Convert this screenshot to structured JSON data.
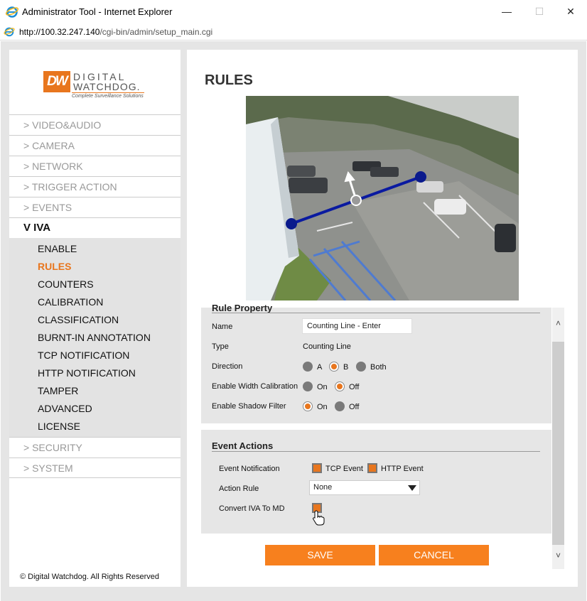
{
  "window": {
    "title": "Administrator Tool - Internet Explorer",
    "url_host": "http://100.32.247.140",
    "url_path": "/cgi-bin/admin/setup_main.cgi",
    "minimize": "—",
    "maximize": "☐",
    "close": "✕"
  },
  "logo": {
    "mark": "DW",
    "line1": "DIGITAL",
    "line2": "WATCHDOG.",
    "tagline": "Complete Surveillance Solutions"
  },
  "nav": {
    "items_top": [
      "> VIDEO&AUDIO",
      "> CAMERA",
      "> NETWORK",
      "> TRIGGER ACTION",
      "> EVENTS"
    ],
    "active": "V IVA",
    "sub_items": [
      "ENABLE",
      "RULES",
      "COUNTERS",
      "CALIBRATION",
      "CLASSIFICATION",
      "BURNT-IN ANNOTATION",
      "TCP NOTIFICATION",
      "HTTP NOTIFICATION",
      "TAMPER",
      "ADVANCED",
      "LICENSE"
    ],
    "current_sub": "RULES",
    "items_bottom": [
      "> SECURITY",
      "> SYSTEM"
    ]
  },
  "copyright": "© Digital Watchdog. All Rights Reserved",
  "page": {
    "title": "RULES"
  },
  "rule_property": {
    "section_title": "Rule Property",
    "name_label": "Name",
    "name_value": "Counting Line - Enter",
    "type_label": "Type",
    "type_value": "Counting Line",
    "direction_label": "Direction",
    "direction_options": [
      "A",
      "B",
      "Both"
    ],
    "direction_selected": "B",
    "width_cal_label": "Enable Width Calibration",
    "width_cal_on": "On",
    "width_cal_off": "Off",
    "width_cal_selected": "Off",
    "shadow_label": "Enable Shadow Filter",
    "shadow_on": "On",
    "shadow_off": "Off",
    "shadow_selected": "On"
  },
  "event_actions": {
    "section_title": "Event Actions",
    "notification_label": "Event Notification",
    "tcp_event": "TCP Event",
    "http_event": "HTTP Event",
    "tcp_checked": true,
    "http_checked": true,
    "action_rule_label": "Action Rule",
    "action_rule_value": "None",
    "convert_label": "Convert IVA To MD",
    "convert_checked": true
  },
  "buttons": {
    "save": "SAVE",
    "cancel": "CANCEL"
  },
  "scroll": {
    "up": "˄",
    "down": "˅"
  },
  "colors": {
    "accent": "#f7801e",
    "line": "#0a1aa0",
    "handle": "#0a1a8c"
  }
}
